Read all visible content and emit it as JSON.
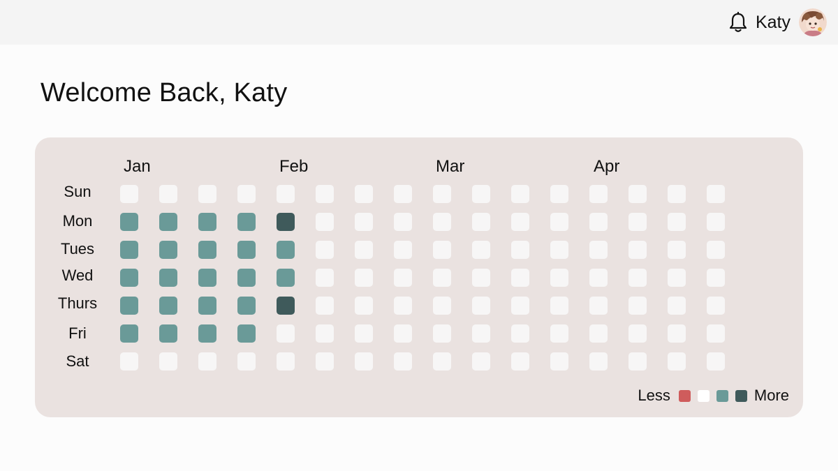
{
  "header": {
    "username": "Katy",
    "bell_icon": "bell-icon",
    "avatar_icon": "avatar"
  },
  "main": {
    "welcome": "Welcome Back, Katy"
  },
  "calendar": {
    "months": [
      "Jan",
      "Feb",
      "Mar",
      "Apr"
    ],
    "days": [
      "Sun",
      "Mon",
      "Tues",
      "Wed",
      "Thurs",
      "Fri",
      "Sat"
    ],
    "weeks": 16,
    "levels_legend": {
      "less_label": "Less",
      "more_label": "More"
    },
    "colors": {
      "empty": "#f7f6f6",
      "level0": "#ffffff",
      "level_low": "#cf5c5c",
      "level1": "#6a9a98",
      "level2": "#3f5a5b",
      "card_bg": "#eae2e0"
    },
    "activity_levels": [
      [
        0,
        0,
        0,
        0,
        0,
        0,
        0,
        0,
        0,
        0,
        0,
        0,
        0,
        0,
        0,
        0
      ],
      [
        1,
        1,
        1,
        1,
        2,
        0,
        0,
        0,
        0,
        0,
        0,
        0,
        0,
        0,
        0,
        0
      ],
      [
        1,
        1,
        1,
        1,
        1,
        0,
        0,
        0,
        0,
        0,
        0,
        0,
        0,
        0,
        0,
        0
      ],
      [
        1,
        1,
        1,
        1,
        1,
        0,
        0,
        0,
        0,
        0,
        0,
        0,
        0,
        0,
        0,
        0
      ],
      [
        1,
        1,
        1,
        1,
        2,
        0,
        0,
        0,
        0,
        0,
        0,
        0,
        0,
        0,
        0,
        0
      ],
      [
        1,
        1,
        1,
        1,
        0,
        0,
        0,
        0,
        0,
        0,
        0,
        0,
        0,
        0,
        0,
        0
      ],
      [
        0,
        0,
        0,
        0,
        0,
        0,
        0,
        0,
        0,
        0,
        0,
        0,
        0,
        0,
        0,
        0
      ]
    ]
  }
}
